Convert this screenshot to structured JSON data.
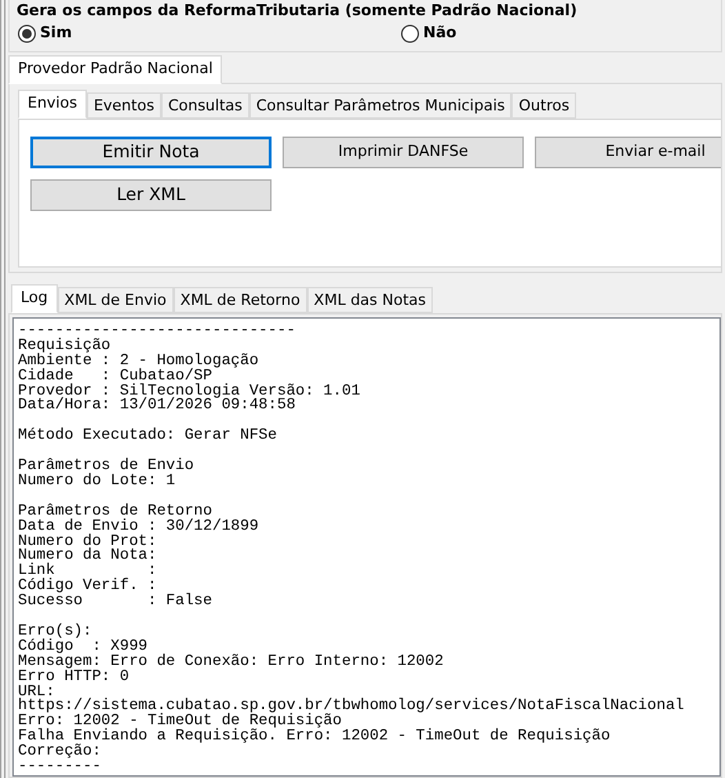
{
  "reforma_group": {
    "title": "Gera os campos da ReformaTributaria (somente Padrão Nacional)",
    "options": [
      {
        "label": "Sim",
        "selected": true
      },
      {
        "label": "Não",
        "selected": false
      }
    ]
  },
  "provider_tabs": [
    {
      "label": "Provedor Padrão Nacional",
      "selected": true
    }
  ],
  "action_tabs": [
    {
      "label": "Envios",
      "selected": true
    },
    {
      "label": "Eventos",
      "selected": false
    },
    {
      "label": "Consultas",
      "selected": false
    },
    {
      "label": "Consultar Parâmetros Municipais",
      "selected": false
    },
    {
      "label": "Outros",
      "selected": false
    }
  ],
  "buttons": [
    {
      "label": "Emitir Nota",
      "focused": true,
      "kind": "big"
    },
    {
      "label": "Imprimir DANFSe",
      "focused": false,
      "kind": "small"
    },
    {
      "label": "Enviar e-mail",
      "focused": false,
      "kind": "small"
    },
    {
      "label": "Ler XML",
      "focused": false,
      "kind": "big"
    }
  ],
  "log_tabs": [
    {
      "label": "Log",
      "selected": true
    },
    {
      "label": "XML de Envio",
      "selected": false
    },
    {
      "label": "XML de Retorno",
      "selected": false
    },
    {
      "label": "XML das Notas",
      "selected": false
    }
  ],
  "log_blocks": [
    [
      "------------------------------",
      "Requisição",
      "Ambiente : 2 - Homologação",
      "Cidade   : Cubatao/SP",
      "Provedor : SilTecnologia Versão: 1.01",
      "Data/Hora: 13/01/2026 09:48:58"
    ],
    [
      "Método Executado: Gerar NFSe"
    ],
    [
      "Parâmetros de Envio",
      "Numero do Lote: 1"
    ],
    [
      "Parâmetros de Retorno",
      "Data de Envio : 30/12/1899",
      "Numero do Prot:",
      "Numero da Nota:",
      "Link          :",
      "Código Verif. :",
      "Sucesso       : False"
    ],
    [
      "Erro(s):",
      "Código  : X999",
      "Mensagem: Erro de Conexão: Erro Interno: 12002",
      "Erro HTTP: 0",
      "URL:",
      "https://sistema.cubatao.sp.gov.br/tbwhomolog/services/NotaFiscalNacional",
      "Erro: 12002 - TimeOut de Requisição",
      "Falha Enviando a Requisição. Erro: 12002 - TimeOut de Requisição",
      "Correção:",
      "---------"
    ]
  ]
}
